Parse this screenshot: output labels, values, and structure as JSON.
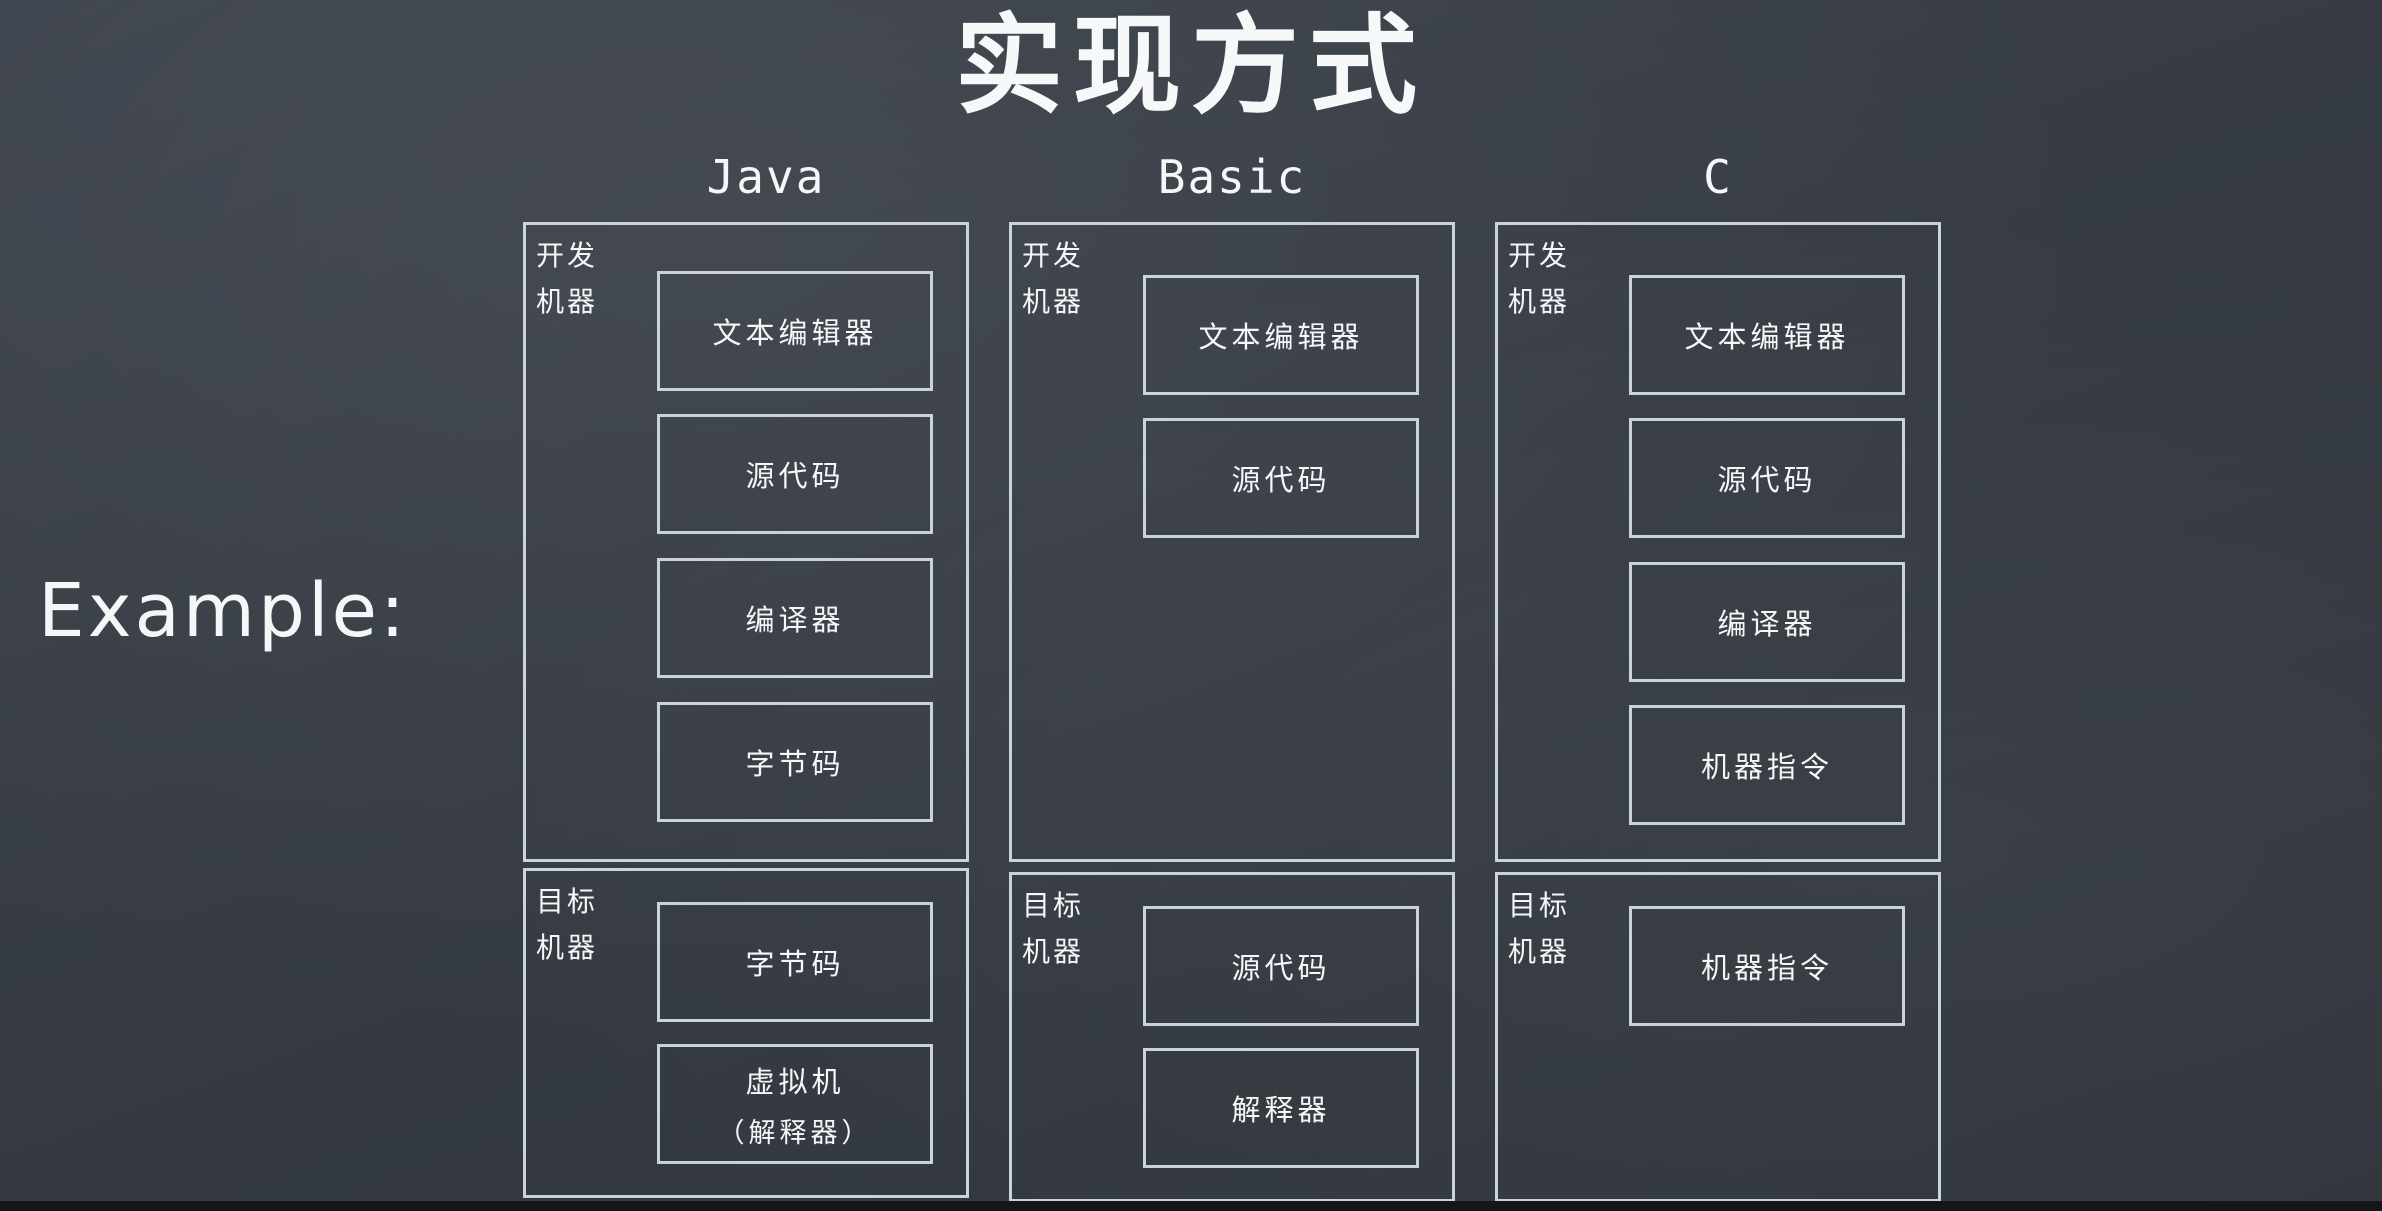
{
  "title": "实现方式",
  "example_label": "Example:",
  "columns": [
    {
      "header": "Java",
      "dev": {
        "label_line1": "开发",
        "label_line2": "机器",
        "items": [
          "文本编辑器",
          "源代码",
          "编译器",
          "字节码"
        ]
      },
      "target": {
        "label_line1": "目标",
        "label_line2": "机器",
        "items": [
          {
            "main": "字节码",
            "sub": ""
          },
          {
            "main": "虚拟机",
            "sub": "（解释器）"
          }
        ]
      }
    },
    {
      "header": "Basic",
      "dev": {
        "label_line1": "开发",
        "label_line2": "机器",
        "items": [
          "文本编辑器",
          "源代码"
        ]
      },
      "target": {
        "label_line1": "目标",
        "label_line2": "机器",
        "items": [
          {
            "main": "源代码",
            "sub": ""
          },
          {
            "main": "解释器",
            "sub": ""
          }
        ]
      }
    },
    {
      "header": "C",
      "dev": {
        "label_line1": "开发",
        "label_line2": "机器",
        "items": [
          "文本编辑器",
          "源代码",
          "编译器",
          "机器指令"
        ]
      },
      "target": {
        "label_line1": "目标",
        "label_line2": "机器",
        "items": [
          {
            "main": "机器指令",
            "sub": ""
          }
        ]
      }
    }
  ]
}
